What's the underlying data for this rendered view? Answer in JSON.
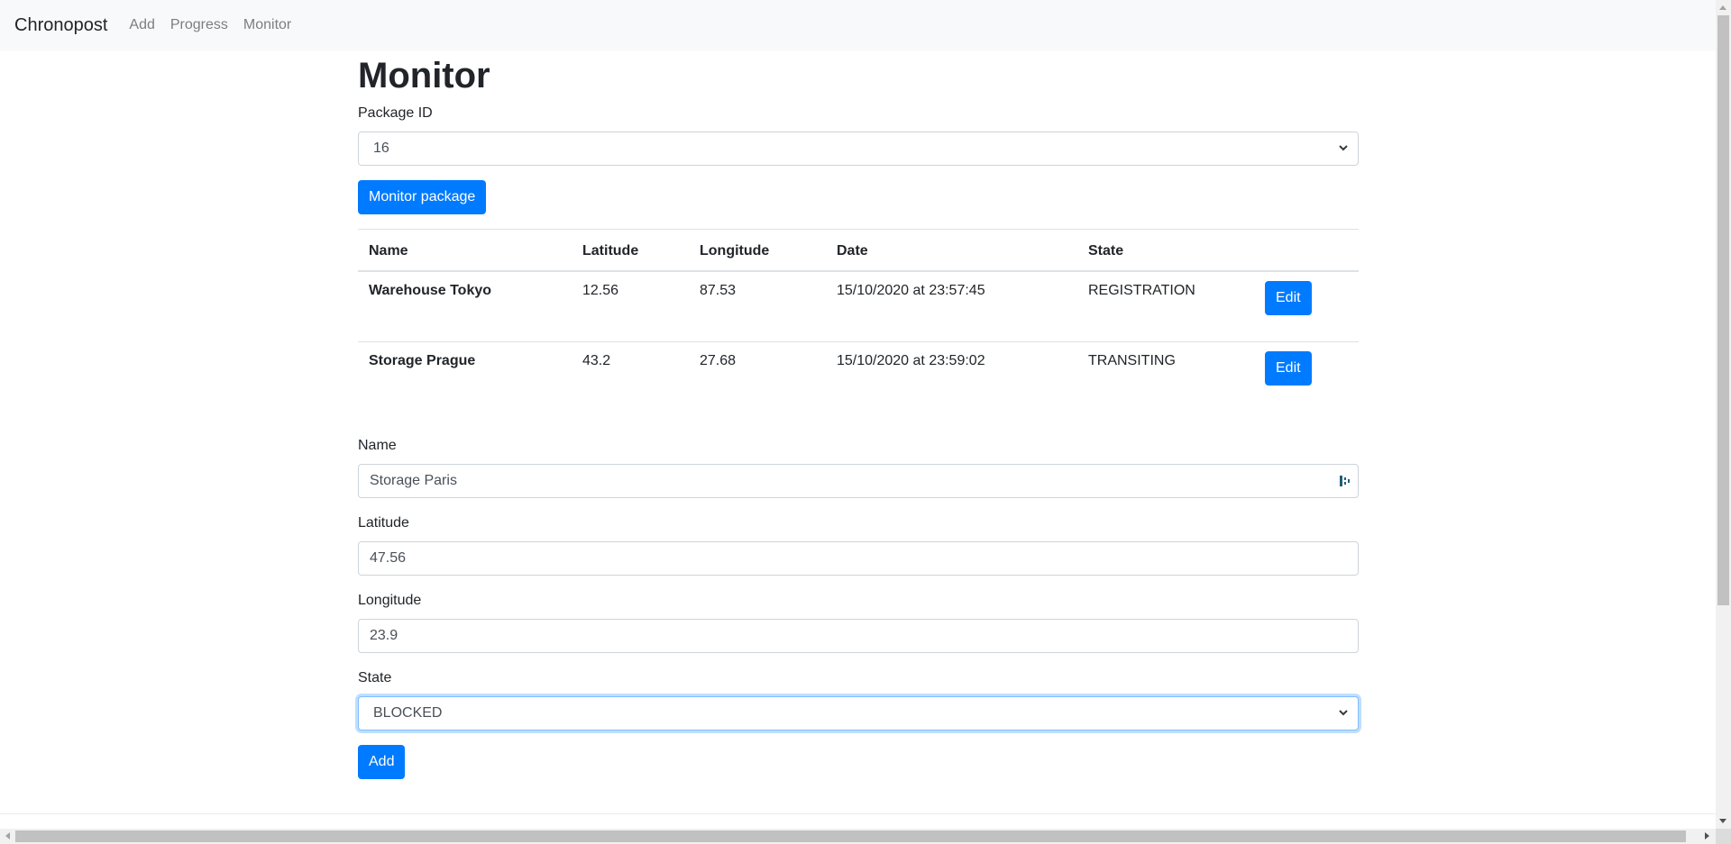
{
  "navbar": {
    "brand": "Chronopost",
    "links": [
      "Add",
      "Progress",
      "Monitor"
    ]
  },
  "page": {
    "title": "Monitor"
  },
  "package_select": {
    "label": "Package ID",
    "value": "16"
  },
  "monitor_button": "Monitor package",
  "table": {
    "headers": [
      "Name",
      "Latitude",
      "Longitude",
      "Date",
      "State",
      ""
    ],
    "rows": [
      {
        "name": "Warehouse Tokyo",
        "latitude": "12.56",
        "longitude": "87.53",
        "date": "15/10/2020 at 23:57:45",
        "state": "REGISTRATION",
        "action": "Edit"
      },
      {
        "name": "Storage Prague",
        "latitude": "43.2",
        "longitude": "27.68",
        "date": "15/10/2020 at 23:59:02",
        "state": "TRANSITING",
        "action": "Edit"
      }
    ]
  },
  "form": {
    "name": {
      "label": "Name",
      "value": "Storage Paris"
    },
    "latitude": {
      "label": "Latitude",
      "value": "47.56"
    },
    "longitude": {
      "label": "Longitude",
      "value": "23.9"
    },
    "state": {
      "label": "State",
      "value": "BLOCKED"
    },
    "submit": "Add"
  },
  "colors": {
    "primary": "#007bff",
    "navbar_bg": "#f8f9fa",
    "focus_border": "#80bdff"
  },
  "icons": {
    "select_chevron": "chevron-down-icon",
    "password_manager": "password-manager-icon"
  }
}
